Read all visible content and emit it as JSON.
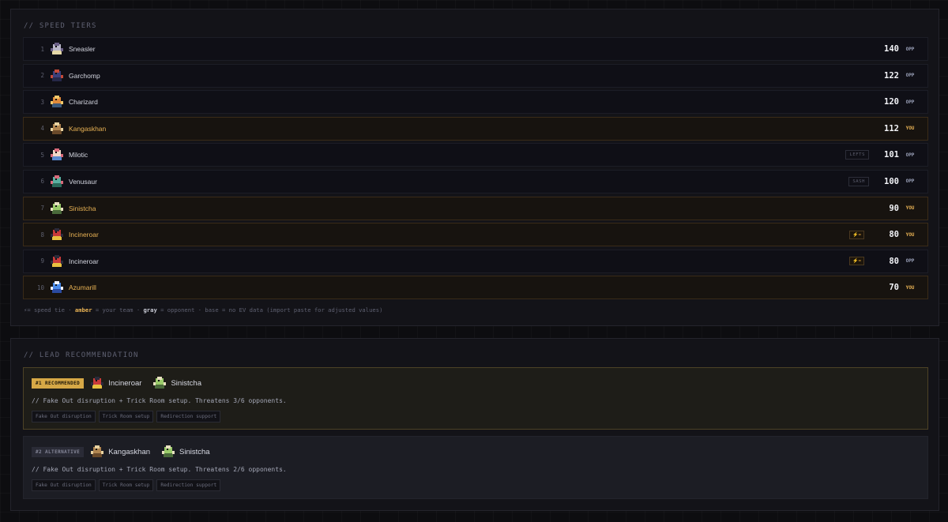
{
  "speed_tiers": {
    "title": "// SPEED TIERS",
    "rows": [
      {
        "rank": "1",
        "name": "Sneasler",
        "icon": "sneasler-sprite",
        "item": "",
        "tie": "",
        "speed": "140",
        "side": "OPP",
        "you": false
      },
      {
        "rank": "2",
        "name": "Garchomp",
        "icon": "garchomp-sprite",
        "item": "",
        "tie": "",
        "speed": "122",
        "side": "OPP",
        "you": false
      },
      {
        "rank": "3",
        "name": "Charizard",
        "icon": "charizard-sprite",
        "item": "",
        "tie": "",
        "speed": "120",
        "side": "OPP",
        "you": false
      },
      {
        "rank": "4",
        "name": "Kangaskhan",
        "icon": "kangaskhan-sprite",
        "item": "",
        "tie": "",
        "speed": "112",
        "side": "YOU",
        "you": true
      },
      {
        "rank": "5",
        "name": "Milotic",
        "icon": "milotic-sprite",
        "item": "LEFTS",
        "tie": "",
        "speed": "101",
        "side": "OPP",
        "you": false
      },
      {
        "rank": "6",
        "name": "Venusaur",
        "icon": "venusaur-sprite",
        "item": "SASH",
        "tie": "",
        "speed": "100",
        "side": "OPP",
        "you": false
      },
      {
        "rank": "7",
        "name": "Sinistcha",
        "icon": "sinistcha-sprite",
        "item": "",
        "tie": "",
        "speed": "90",
        "side": "YOU",
        "you": true
      },
      {
        "rank": "8",
        "name": "Incineroar",
        "icon": "incineroar-sprite",
        "item": "",
        "tie": "⚡=",
        "speed": "80",
        "side": "YOU",
        "you": true
      },
      {
        "rank": "9",
        "name": "Incineroar",
        "icon": "incineroar-sprite",
        "item": "",
        "tie": "⚡=",
        "speed": "80",
        "side": "OPP",
        "you": false
      },
      {
        "rank": "10",
        "name": "Azumarill",
        "icon": "azumarill-sprite",
        "item": "",
        "tie": "",
        "speed": "70",
        "side": "YOU",
        "you": true
      }
    ],
    "legend": {
      "tie": "⚡= speed tie · ",
      "amber": "amber",
      "amber_desc": " = your team · ",
      "gray": "gray",
      "gray_desc": " = opponent · base = no EV data (import paste for adjusted values)"
    }
  },
  "lead_recommendation": {
    "title": "// LEAD RECOMMENDATION",
    "cards": [
      {
        "badge": "#1 RECOMMENDED",
        "mons": [
          {
            "name": "Incineroar",
            "icon": "incineroar-sprite"
          },
          {
            "name": "Sinistcha",
            "icon": "sinistcha-sprite"
          }
        ],
        "desc": "// Fake Out disruption + Trick Room setup. Threatens 3/6 opponents.",
        "chips": [
          "Fake Out disruption",
          "Trick Room setup",
          "Redirection support"
        ]
      },
      {
        "badge": "#2 ALTERNATIVE",
        "mons": [
          {
            "name": "Kangaskhan",
            "icon": "kangaskhan-sprite"
          },
          {
            "name": "Sinistcha",
            "icon": "sinistcha-sprite"
          }
        ],
        "desc": "// Fake Out disruption + Trick Room setup. Threatens 2/6 opponents.",
        "chips": [
          "Fake Out disruption",
          "Trick Room setup",
          "Redirection support"
        ]
      }
    ]
  },
  "colors": {
    "accent": "#e8b254",
    "opponent": "#9aa0b8",
    "background": "#0d0d10"
  }
}
